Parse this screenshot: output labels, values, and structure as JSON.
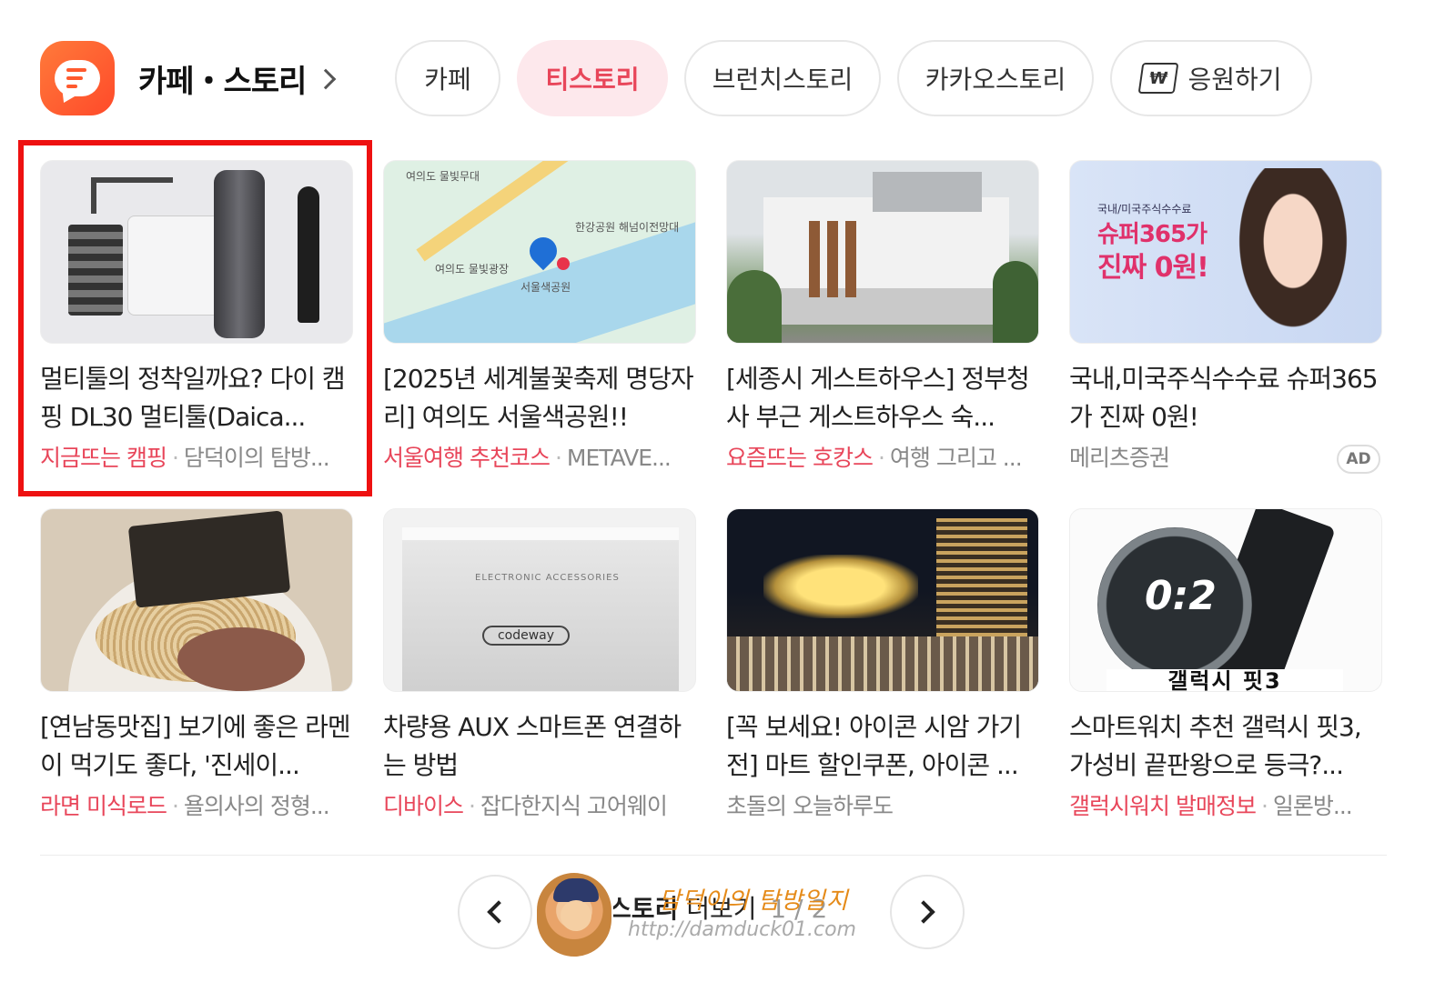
{
  "header": {
    "title": "카페・스토리"
  },
  "tabs": [
    {
      "label": "카페",
      "active": false
    },
    {
      "label": "티스토리",
      "active": true
    },
    {
      "label": "브런치스토리",
      "active": false
    },
    {
      "label": "카카오스토리",
      "active": false
    },
    {
      "label": "응원하기",
      "active": false,
      "icon": "won-ticket-icon"
    }
  ],
  "colors": {
    "accent": "#e8465a",
    "accent_bg": "#fde8ec",
    "app_icon": "#ff5a2e",
    "highlight_box": "#ee1111"
  },
  "cards": [
    {
      "title": "멀티툴의 정착일까요? 다이 캠핑 DL30 멀티툴(Daica...",
      "tag": "지금뜨는 캠핑",
      "source": "담덕이의 탐방...",
      "thumb": "multitool-photo"
    },
    {
      "title": "[2025년 세계불꽃축제 명당자리] 여의도 서울색공원!!",
      "tag": "서울여행 추천코스",
      "source": "METAVE...",
      "thumb": "map-image",
      "map_labels": [
        "여의도 물빛무대",
        "한강공원 해넘이전망대",
        "여의도 물빛광장",
        "서울색공원"
      ]
    },
    {
      "title": "[세종시 게스트하우스] 정부청사 부근 게스트하우스 숙...",
      "tag": "요즘뜨는 호캉스",
      "source": "여행 그리고 ...",
      "thumb": "building-photo"
    },
    {
      "title": "국내,미국주식수수료 슈퍼365가 진짜 0원!",
      "tag": "",
      "source": "메리츠증권",
      "ad": "AD",
      "thumb": "ad-banner",
      "ad_lines": [
        "국내/미국주식수수료",
        "슈퍼365가",
        "진짜 0원!"
      ]
    },
    {
      "title": "[연남동맛집] 보기에 좋은 라멘이 먹기도 좋다, '진세이...",
      "tag": "라면 미식로드",
      "source": "욜의사의 정형...",
      "thumb": "ramen-photo"
    },
    {
      "title": "차량용 AUX 스마트폰 연결하는 방법",
      "tag": "디바이스",
      "source": "잡다한지식 고어웨이",
      "thumb": "pouch-photo",
      "pouch_lines": [
        "ELECTRONIC ACCESSORIES",
        "codeway"
      ]
    },
    {
      "title": "[꼭 보세요! 아이콘 시암 가기전] 마트 할인쿠폰, 아이콘 ...",
      "tag": "",
      "source": "초돌의 오늘하루도",
      "thumb": "night-city-photo"
    },
    {
      "title": "스마트워치 추천 갤럭시 핏3, 가성비 끝판왕으로 등극?...",
      "tag": "갤럭시워치 발매정보",
      "source": "일론방...",
      "thumb": "watch-photo",
      "watch_lines": [
        "0:2",
        "갤럭시 핏3"
      ]
    }
  ],
  "pager": {
    "more_prefix": "스토리",
    "more_label": "더보기",
    "current": "1",
    "total": "2",
    "prev_icon": "chevron-left-icon",
    "next_icon": "chevron-right-icon"
  },
  "watermark": {
    "name": "담덕이의 탐방일지",
    "url": "http://damduck01.com"
  }
}
